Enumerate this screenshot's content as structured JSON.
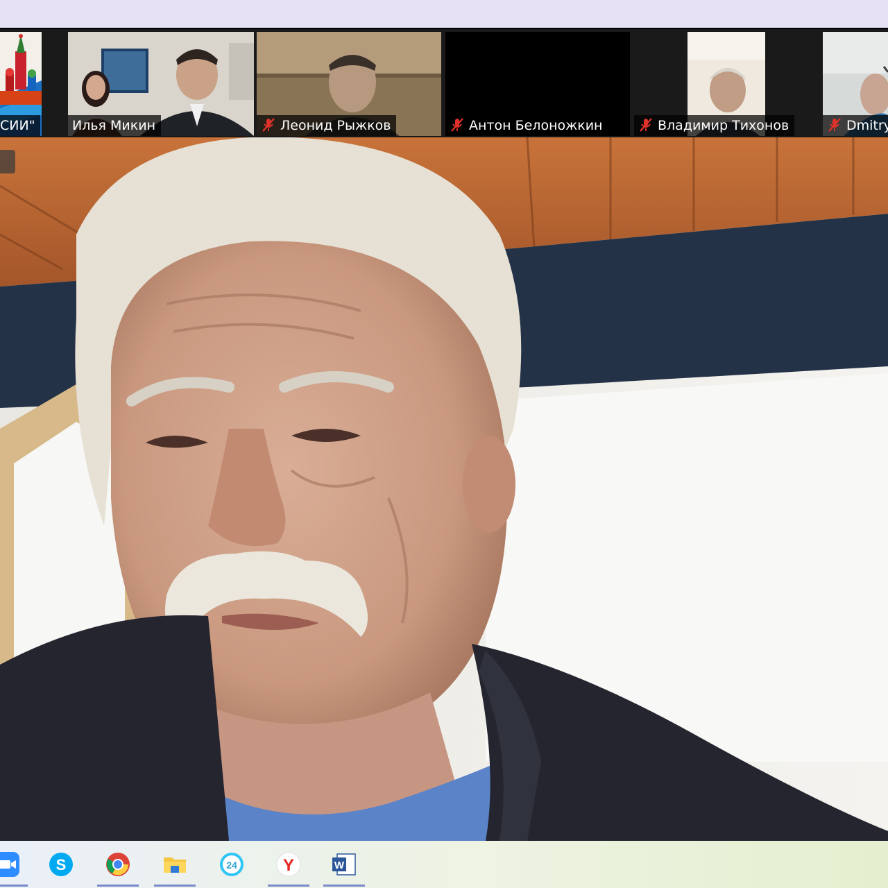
{
  "participants": [
    {
      "name": "СИИ\"",
      "muted": false
    },
    {
      "name": "Илья Микин",
      "muted": false
    },
    {
      "name": "Леонид Рыжков",
      "muted": true
    },
    {
      "name": "Антон Белоножкин",
      "muted": true
    },
    {
      "name": "Владимир Тихонов",
      "muted": true
    },
    {
      "name": "Dmitry",
      "muted": true
    }
  ],
  "taskbar": {
    "apps": [
      "zoom-app-icon",
      "skype-app-icon",
      "chrome-app-icon",
      "file-explorer-app-icon",
      "bitrix24-app-icon",
      "yandex-browser-app-icon",
      "word-app-icon"
    ],
    "bitrix_label": "24",
    "yandex_label": "Y",
    "word_label": "W"
  },
  "colors": {
    "strip_background": "#1a1a1a",
    "taskbar_underline": "#7a89c9",
    "mute_icon": "#e0322b"
  }
}
